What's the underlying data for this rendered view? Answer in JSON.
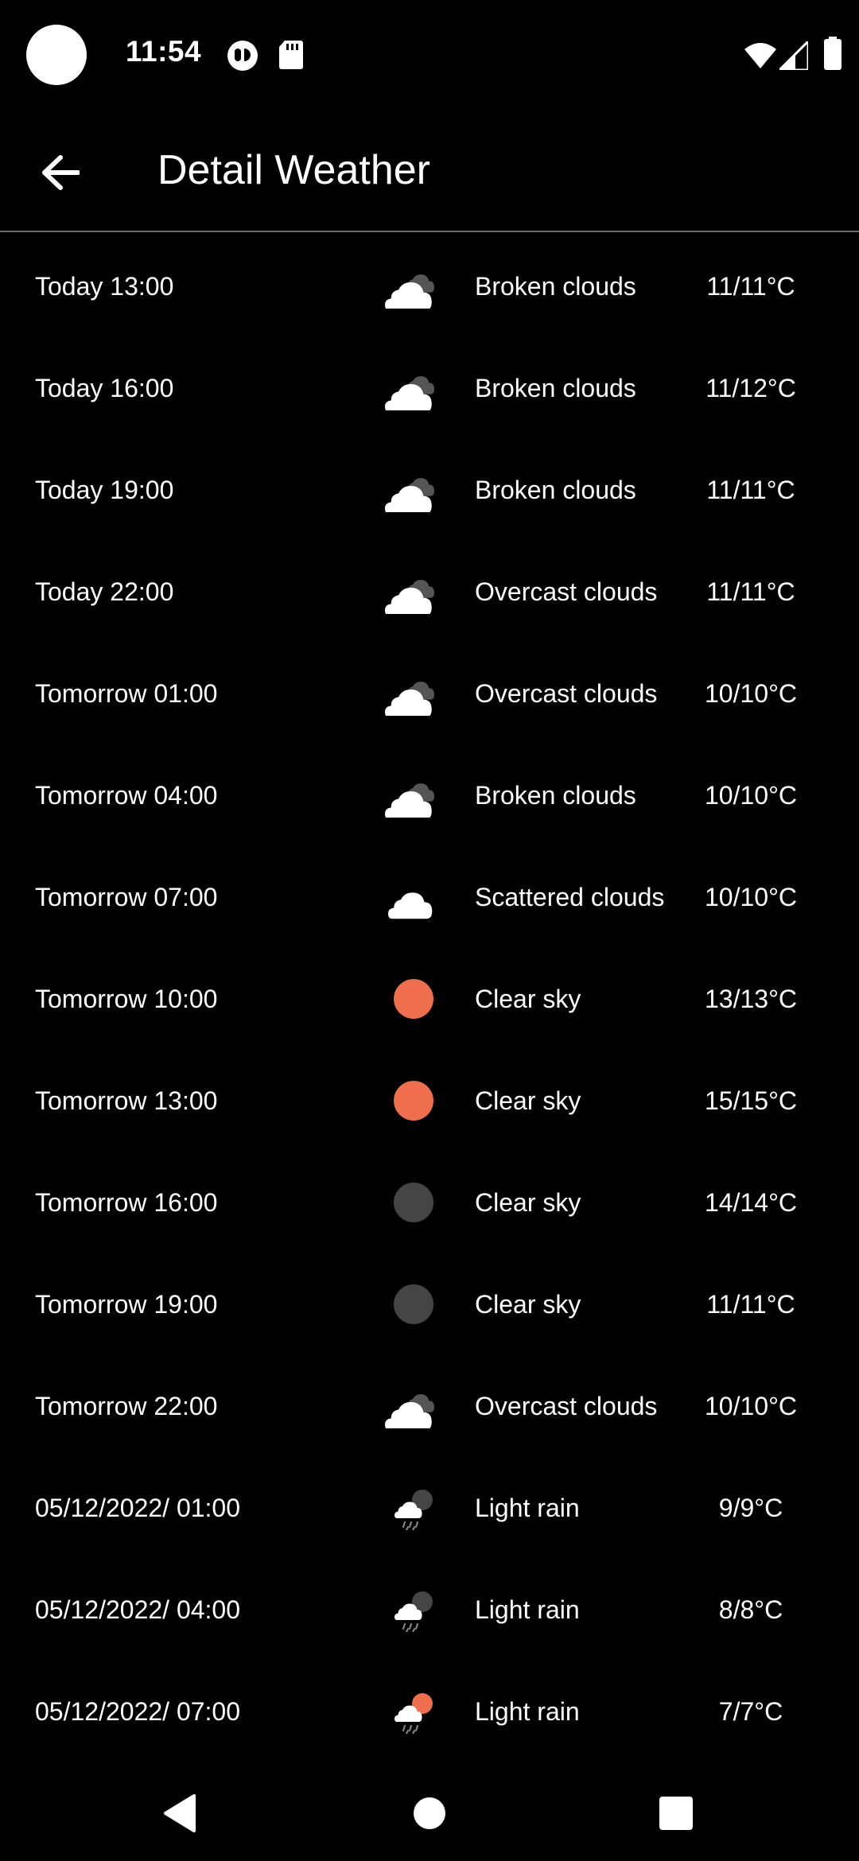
{
  "status_bar": {
    "time": "11:54",
    "icons": [
      "data-saver-icon",
      "sd-card-icon",
      "wifi-icon",
      "cell-signal-icon",
      "battery-icon"
    ]
  },
  "app_bar": {
    "title": "Detail Weather",
    "back_icon": "arrow-back-icon"
  },
  "colors": {
    "background": "#000000",
    "sun": "#ee6e4e",
    "moon": "#454545",
    "cloud_front": "#ffffff",
    "cloud_back": "#555555",
    "divider": "#6b6b6b"
  },
  "forecast": [
    {
      "time": "Today 13:00",
      "icon": "broken-clouds",
      "description": "Broken clouds",
      "temp": "11/11°C"
    },
    {
      "time": "Today 16:00",
      "icon": "broken-clouds",
      "description": "Broken clouds",
      "temp": "11/12°C"
    },
    {
      "time": "Today 19:00",
      "icon": "broken-clouds",
      "description": "Broken clouds",
      "temp": "11/11°C"
    },
    {
      "time": "Today 22:00",
      "icon": "broken-clouds",
      "description": "Overcast clouds",
      "temp": "11/11°C"
    },
    {
      "time": "Tomorrow 01:00",
      "icon": "broken-clouds",
      "description": "Overcast clouds",
      "temp": "10/10°C"
    },
    {
      "time": "Tomorrow 04:00",
      "icon": "broken-clouds",
      "description": "Broken clouds",
      "temp": "10/10°C"
    },
    {
      "time": "Tomorrow 07:00",
      "icon": "scattered-clouds",
      "description": "Scattered clouds",
      "temp": "10/10°C"
    },
    {
      "time": "Tomorrow 10:00",
      "icon": "clear-day",
      "description": "Clear sky",
      "temp": "13/13°C"
    },
    {
      "time": "Tomorrow 13:00",
      "icon": "clear-day",
      "description": "Clear sky",
      "temp": "15/15°C"
    },
    {
      "time": "Tomorrow 16:00",
      "icon": "clear-night",
      "description": "Clear sky",
      "temp": "14/14°C"
    },
    {
      "time": "Tomorrow 19:00",
      "icon": "clear-night",
      "description": "Clear sky",
      "temp": "11/11°C"
    },
    {
      "time": "Tomorrow 22:00",
      "icon": "broken-clouds",
      "description": "Overcast clouds",
      "temp": "10/10°C"
    },
    {
      "time": "05/12/2022/ 01:00",
      "icon": "rain-night",
      "description": "Light rain",
      "temp": "9/9°C"
    },
    {
      "time": "05/12/2022/ 04:00",
      "icon": "rain-night",
      "description": "Light rain",
      "temp": "8/8°C"
    },
    {
      "time": "05/12/2022/ 07:00",
      "icon": "rain-day",
      "description": "Light rain",
      "temp": "7/7°C"
    }
  ],
  "nav_bar": {
    "icons": [
      "nav-back-icon",
      "nav-home-icon",
      "nav-recents-icon"
    ]
  }
}
